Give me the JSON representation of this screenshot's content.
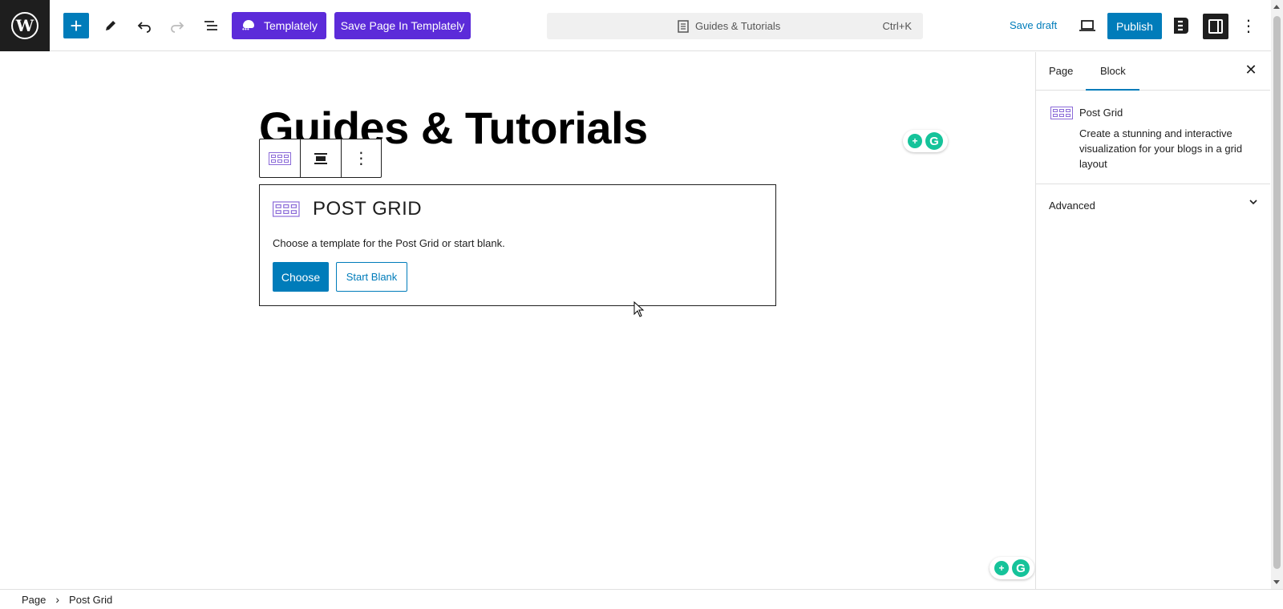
{
  "toolbar": {
    "templately_label": "Templately",
    "save_templately_label": "Save Page In Templately",
    "doc_title": "Guides & Tutorials",
    "shortcut": "Ctrl+K",
    "save_draft": "Save draft",
    "publish": "Publish"
  },
  "editor": {
    "page_title": "Guides & Tutorials",
    "post_grid": {
      "title": "POST GRID",
      "description": "Choose a template for the Post Grid or start blank.",
      "choose_label": "Choose",
      "start_blank_label": "Start Blank"
    }
  },
  "sidebar": {
    "tabs": [
      {
        "label": "Page"
      },
      {
        "label": "Block",
        "active": true
      }
    ],
    "block_card": {
      "title": "Post Grid",
      "description": "Create a stunning and interactive visualization for your blogs in a grid layout"
    },
    "advanced_label": "Advanced"
  },
  "breadcrumb": {
    "items": [
      "Page",
      "Post Grid"
    ]
  },
  "colors": {
    "accent": "#007cba",
    "templately": "#5c2bd9",
    "grammarly": "#15c39a"
  }
}
